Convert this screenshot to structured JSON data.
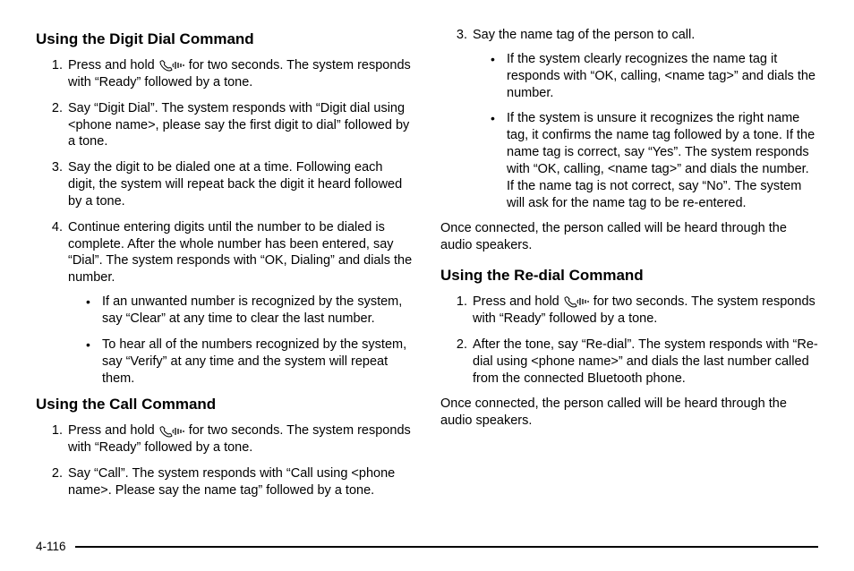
{
  "left": {
    "h1": "Using the Digit Dial Command",
    "digit": [
      {
        "pre": "Press and hold ",
        "post": " for two seconds. The system responds with “Ready” followed by a tone."
      },
      {
        "text": "Say “Digit Dial”. The system responds with “Digit dial using <phone name>, please say the first digit to dial” followed by a tone."
      },
      {
        "text": "Say the digit to be dialed one at a time. Following each digit, the system will repeat back the digit it heard followed by a tone."
      },
      {
        "text": "Continue entering digits until the number to be dialed is complete. After the whole number has been entered, say “Dial”. The system responds with “OK, Dialing” and dials the number."
      }
    ],
    "digit_sub": [
      "If an unwanted number is recognized by the system, say “Clear” at any time to clear the last number.",
      "To hear all of the numbers recognized by the system, say “Verify” at any time and the system will repeat them."
    ],
    "h2": "Using the Call Command",
    "call": [
      {
        "pre": "Press and hold ",
        "post": " for two seconds. The system responds with “Ready” followed by a tone."
      },
      {
        "text": "Say “Call”. The system responds with “Call using <phone name>. Please say the name tag” followed by a tone."
      }
    ]
  },
  "right": {
    "call_cont": [
      {
        "text": "Say the name tag of the person to call."
      }
    ],
    "call_sub": [
      "If the system clearly recognizes the name tag it responds with “OK, calling, <name tag>” and dials the number.",
      "If the system is unsure it recognizes the right name tag, it confirms the name tag followed by a tone. If the name tag is correct, say “Yes”. The system responds with “OK, calling, <name tag>” and dials the number. If the name tag is not correct, say “No”. The system will ask for the name tag to be re-entered."
    ],
    "p1": "Once connected, the person called will be heard through the audio speakers.",
    "h1": "Using the Re-dial Command",
    "redial": [
      {
        "pre": "Press and hold ",
        "post": " for two seconds. The system responds with “Ready” followed by a tone."
      },
      {
        "text": "After the tone, say “Re-dial”. The system responds with “Re-dial using <phone name>” and dials the last number called from the connected Bluetooth phone."
      }
    ],
    "p2": "Once connected, the person called will be heard through the audio speakers."
  },
  "page_number": "4-116"
}
